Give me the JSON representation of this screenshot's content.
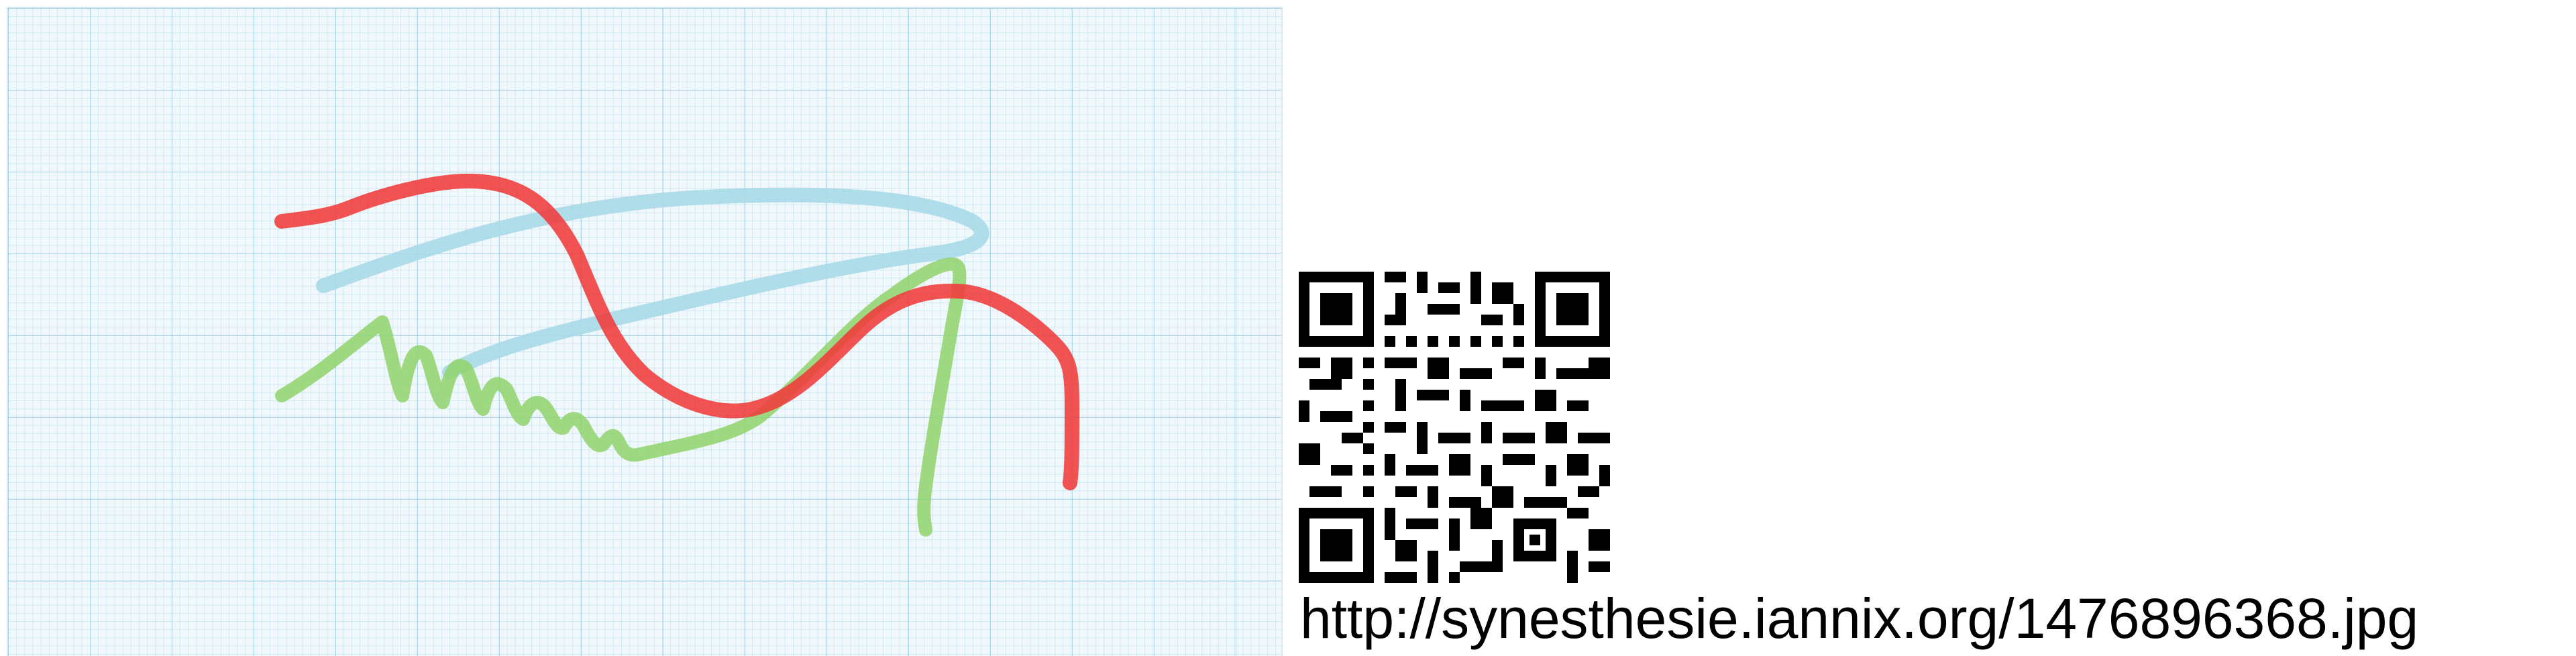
{
  "image": {
    "url_caption": "http://synesthesie.iannix.org/1476896368.jpg",
    "strokes": [
      {
        "name": "blue-stroke",
        "color": "#a9d9e8"
      },
      {
        "name": "green-stroke",
        "color": "#8fd36b"
      },
      {
        "name": "red-stroke",
        "color": "#f03a3a"
      }
    ],
    "qr_code_icon": "qr-code-icon"
  }
}
